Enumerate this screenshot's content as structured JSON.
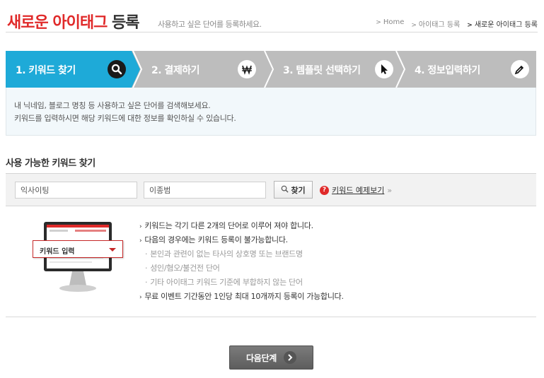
{
  "header": {
    "title_red": "새로운 아이태그",
    "title_dark": " 등록",
    "subtitle": "사용하고 싶은 단어를 등록하세요.",
    "breadcrumb": [
      "Home",
      "아이태그 등록",
      "새로운 아이태그 등록"
    ]
  },
  "steps": [
    {
      "label": "1. 키워드 찾기",
      "icon": "search-icon",
      "active": true
    },
    {
      "label": "2. 결제하기",
      "icon": "won-icon",
      "active": false
    },
    {
      "label": "3. 템플릿 선택하기",
      "icon": "cursor-icon",
      "active": false
    },
    {
      "label": "4. 정보입력하기",
      "icon": "pencil-icon",
      "active": false
    }
  ],
  "info": {
    "line1": "내 닉네임, 블로그 명칭 등 사용하고 싶은 단어를 검색해보세요.",
    "line2": "키워드를 입력하시면 해당 키워드에 대한 정보를 확인하실 수 있습니다."
  },
  "section_title": "사용 가능한 키워드 찾기",
  "search": {
    "input1_value": "익사이팅",
    "input2_value": "이종범",
    "find_label": "찾기",
    "example_label": "키워드 예제보기"
  },
  "illustration": {
    "tag_label": "키워드 입력"
  },
  "rules": [
    {
      "text": "키워드는 각기 다른 2개의 단어로 이루어 져야 합니다.",
      "sub": false
    },
    {
      "text": "다음의 경우에는 키워드 등록이 불가능합니다.",
      "sub": false
    },
    {
      "text": "본인과 관련이 없는 타사의 상호명 또는 브랜드명",
      "sub": true
    },
    {
      "text": "성인/혐오/불건전 단어",
      "sub": true
    },
    {
      "text": "기타 아이태그 키워드 기준에 부합하지 않는 단어",
      "sub": true
    },
    {
      "text": "무료 이벤트 기간동안 1인당 최대 10개까지 등록이 가능합니다.",
      "sub": false
    }
  ],
  "next_button": "다음단계",
  "colors": {
    "accent_red": "#e02a2a",
    "active_step": "#1eaad8",
    "inactive_step": "#bdbdbd"
  }
}
